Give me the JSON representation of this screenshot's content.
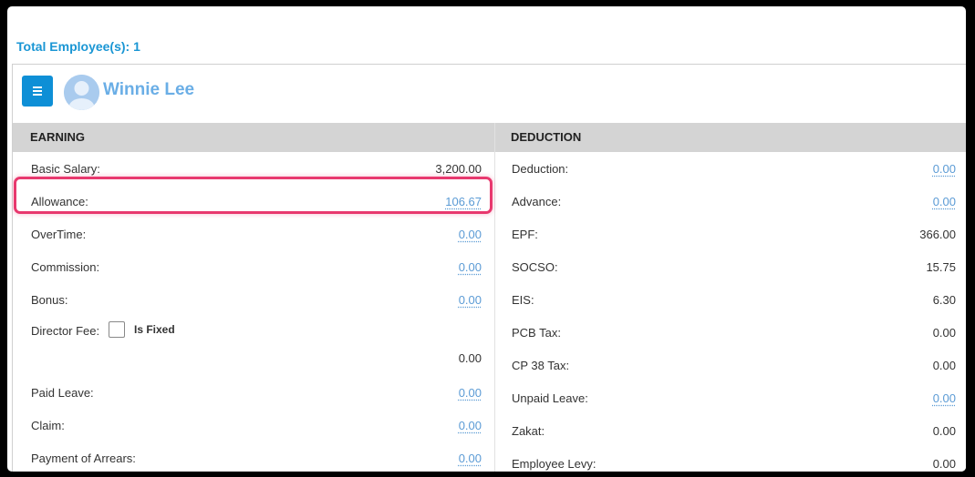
{
  "total_label": "Total Employee(s): 1",
  "employee": {
    "name": "Winnie Lee"
  },
  "earning": {
    "header": "EARNING",
    "rows": [
      {
        "label": "Basic Salary:",
        "value": "3,200.00",
        "link": false
      },
      {
        "label": "Allowance:",
        "value": "106.67",
        "link": true
      },
      {
        "label": "OverTime:",
        "value": "0.00",
        "link": true
      },
      {
        "label": "Commission:",
        "value": "0.00",
        "link": true
      },
      {
        "label": "Bonus:",
        "value": "0.00",
        "link": true
      }
    ],
    "director_fee": {
      "label": "Director Fee:",
      "checkbox_label": "Is Fixed",
      "checked": false,
      "value": "0.00"
    },
    "rows_after": [
      {
        "label": "Paid Leave:",
        "value": "0.00",
        "link": true
      },
      {
        "label": "Claim:",
        "value": "0.00",
        "link": true
      },
      {
        "label": "Payment of Arrears:",
        "value": "0.00",
        "link": true
      }
    ]
  },
  "deduction": {
    "header": "DEDUCTION",
    "rows": [
      {
        "label": "Deduction:",
        "value": "0.00",
        "link": true
      },
      {
        "label": "Advance:",
        "value": "0.00",
        "link": true
      },
      {
        "label": "EPF:",
        "value": "366.00",
        "link": false
      },
      {
        "label": "SOCSO:",
        "value": "15.75",
        "link": false
      },
      {
        "label": "EIS:",
        "value": "6.30",
        "link": false
      },
      {
        "label": "PCB Tax:",
        "value": "0.00",
        "link": false
      },
      {
        "label": "CP 38 Tax:",
        "value": "0.00",
        "link": false
      },
      {
        "label": "Unpaid Leave:",
        "value": "0.00",
        "link": true
      },
      {
        "label": "Zakat:",
        "value": "0.00",
        "link": false
      },
      {
        "label": "Employee Levy:",
        "value": "0.00",
        "link": false
      }
    ]
  },
  "colors": {
    "accent": "#1a96d4",
    "menu_button": "#0e8fd6",
    "employee_name": "#6aaee6",
    "link": "#5b9bd5",
    "highlight": "#e8386e",
    "header_bg": "#d4d4d4"
  },
  "icons": {
    "menu": "hamburger-icon",
    "avatar": "user-avatar-icon"
  }
}
